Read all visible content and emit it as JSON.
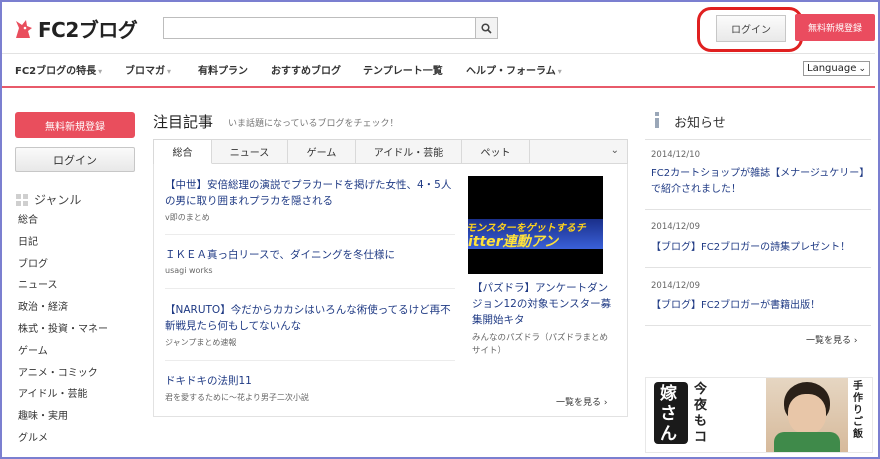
{
  "header": {
    "logo_text": "FC2ブログ",
    "search_placeholder": "",
    "login_label": "ログイン",
    "register_label": "無料新規登録"
  },
  "nav": {
    "items": [
      {
        "label": "FC2ブログの特長",
        "dropdown": true
      },
      {
        "label": "ブロマガ",
        "dropdown": true
      },
      {
        "label": "有料プラン",
        "dropdown": false
      },
      {
        "label": "おすすめブログ",
        "dropdown": false
      },
      {
        "label": "テンプレート一覧",
        "dropdown": false
      },
      {
        "label": "ヘルプ・フォーラム",
        "dropdown": true
      }
    ],
    "language_label": "Language"
  },
  "sidebar": {
    "register_label": "無料新規登録",
    "login_label": "ログイン",
    "genre_heading": "ジャンル",
    "genres": [
      "総合",
      "日記",
      "ブログ",
      "ニュース",
      "政治・経済",
      "株式・投資・マネー",
      "ゲーム",
      "アニメ・コミック",
      "アイドル・芸能",
      "趣味・実用",
      "グルメ"
    ]
  },
  "featured": {
    "title": "注目記事",
    "subtitle": "いま話題になっているブログをチェック！",
    "tabs": [
      "総合",
      "ニュース",
      "ゲーム",
      "アイドル・芸能",
      "ペット"
    ],
    "active_tab": "総合",
    "articles": [
      {
        "title": "【中世】安倍総理の演説でプラカードを掲げた女性、4・5人の男に取り囲まれプラカを隠される",
        "source": "v即のまとめ"
      },
      {
        "title": "ＩＫＥＡ真っ白リースで、ダイニングを冬仕様に",
        "source": "usagi works"
      },
      {
        "title": "【NARUTO】今だからカカシはいろんな術使ってるけど再不斬戦見たら何もしてないんな",
        "source": "ジャンプまとめ速報"
      },
      {
        "title": "ドキドキの法則11",
        "source": "君を愛するために～花より男子二次小説"
      }
    ],
    "image_article": {
      "title": "【パズドラ】アンケートダンジョン12の対象モンスター募集開始キタ",
      "source": "みんなのパズドラ（パズドラまとめサイト）",
      "image_text_1": "モンスターをゲットするチ",
      "image_text_2": "itter連動アン"
    },
    "more_label": "一覧を見る ›"
  },
  "notices": {
    "title": "お知らせ",
    "items": [
      {
        "date": "2014/12/10",
        "title": "FC2カートショップが雑誌【メナージュケリー】で紹介されました！"
      },
      {
        "date": "2014/12/09",
        "title": "【ブログ】FC2ブロガーの詩集プレゼント！"
      },
      {
        "date": "2014/12/09",
        "title": "【ブログ】FC2ブロガーが書籍出版！"
      }
    ],
    "more_label": "一覧を見る ›"
  },
  "banner": {
    "text_1": "嫁さん",
    "text_2": "今夜もコ",
    "text_3": "手作りご飯"
  },
  "colors": {
    "accent_red": "#e94e5d",
    "link_blue": "#1f3a84",
    "highlight_ellipse": "#e02020"
  }
}
